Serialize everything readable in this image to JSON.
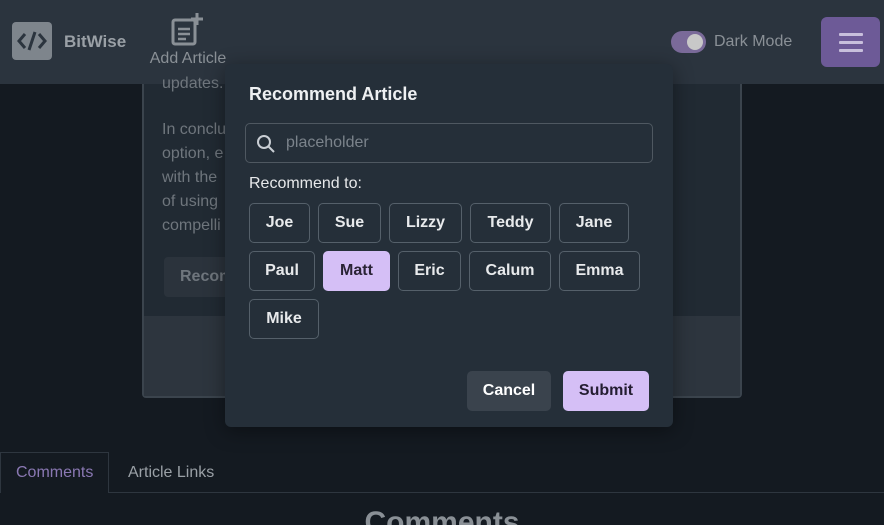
{
  "header": {
    "brand": "BitWise",
    "logo_icon": "code-icon",
    "add_article_label": "Add Article",
    "add_article_icon": "add-document-icon",
    "dark_mode_label": "Dark Mode",
    "dark_mode_on": true,
    "menu_icon": "hamburger-icon",
    "accent_color": "#6d5a97"
  },
  "article": {
    "lines": [
      "updates.",
      "",
      "In conclu",
      "option, e",
      "with the",
      "of using",
      "compelli"
    ],
    "button_label": "Recom"
  },
  "modal": {
    "title": "Recommend Article",
    "search": {
      "placeholder": "placeholder",
      "value": "",
      "icon": "search-icon"
    },
    "recommend_label": "Recommend to:",
    "people": [
      {
        "name": "Joe",
        "selected": false
      },
      {
        "name": "Sue",
        "selected": false
      },
      {
        "name": "Lizzy",
        "selected": false
      },
      {
        "name": "Teddy",
        "selected": false
      },
      {
        "name": "Jane",
        "selected": false
      },
      {
        "name": "Paul",
        "selected": false
      },
      {
        "name": "Matt",
        "selected": true
      },
      {
        "name": "Eric",
        "selected": false
      },
      {
        "name": "Calum",
        "selected": false
      },
      {
        "name": "Emma",
        "selected": false
      },
      {
        "name": "Mike",
        "selected": false
      }
    ],
    "cancel_label": "Cancel",
    "submit_label": "Submit",
    "selected_color": "#d5bff6"
  },
  "tabs": [
    {
      "label": "Comments",
      "active": true
    },
    {
      "label": "Article Links",
      "active": false
    }
  ],
  "comments_heading": "Comments"
}
